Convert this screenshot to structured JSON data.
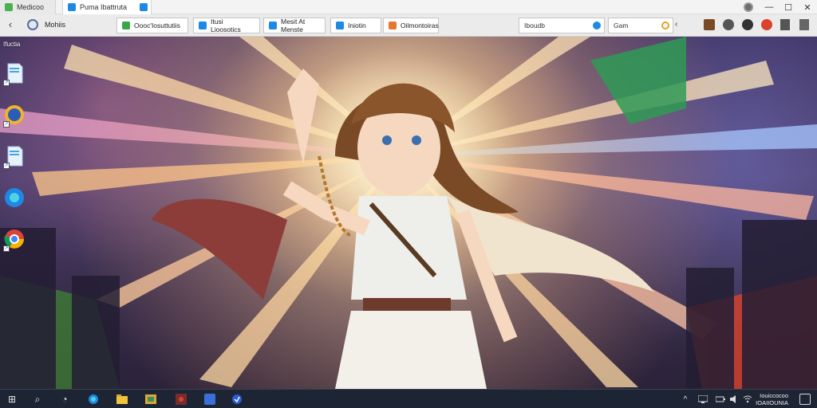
{
  "tabs": [
    {
      "label": "Medicoo"
    },
    {
      "label": "Puma Ibattruta"
    }
  ],
  "window_controls": {
    "minimize": "—",
    "maximize": "☐",
    "close": "✕"
  },
  "toolbar": {
    "back": "‹",
    "site_label": "Mohiis",
    "bookmarks": [
      {
        "label": "Oooc'Iosuttutiis",
        "icon_color": "#3aa64a"
      },
      {
        "label": "Itusi Lioosotics",
        "icon_color": "#1e88e5"
      },
      {
        "label": "Mesit At Menste",
        "icon_color": "#1e88e5"
      },
      {
        "label": "Iniotin",
        "icon_color": "#1e88e5"
      },
      {
        "label": "Oilmontoiras",
        "icon_color": "#e8772e"
      }
    ],
    "search_value": "Iboudb",
    "second_value": "Gam",
    "chevron": "‹"
  },
  "desktop": {
    "folder_label": "Ifuctia",
    "icons": [
      {
        "name": "file-icon",
        "glyph": ""
      },
      {
        "name": "app-icon",
        "glyph": "9"
      },
      {
        "name": "file-icon",
        "glyph": ""
      },
      {
        "name": "edge-icon",
        "glyph": ""
      },
      {
        "name": "chrome-icon",
        "glyph": ""
      }
    ]
  },
  "taskbar": {
    "start": "⊞",
    "search": "⌕",
    "task_view": "◔",
    "clock_time": "Iouiccocoo",
    "clock_date": "IOAIIOUNIA"
  },
  "colors": {
    "accent": "#1e88e5",
    "taskbar": "#1d2433",
    "toolbar": "#ebebeb"
  }
}
